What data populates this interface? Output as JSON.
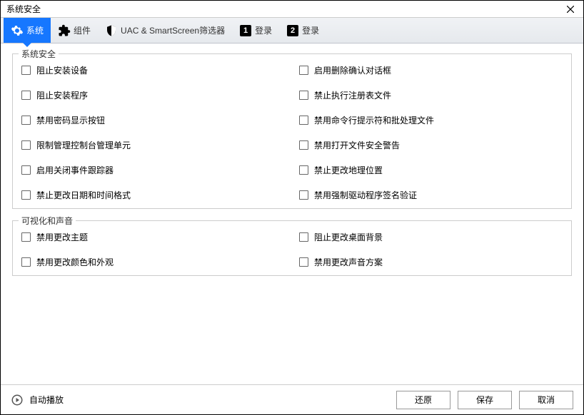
{
  "window": {
    "title": "系统安全"
  },
  "tabs": [
    {
      "label": "系统",
      "icon": "gear"
    },
    {
      "label": "组件",
      "icon": "puzzle"
    },
    {
      "label": "UAC & SmartScreen筛选器",
      "icon": "shield"
    },
    {
      "label": "登录",
      "icon": "num1"
    },
    {
      "label": "登录",
      "icon": "num2"
    }
  ],
  "groups": [
    {
      "title": "系统安全",
      "options": [
        "阻止安装设备",
        "启用删除确认对话框",
        "阻止安装程序",
        "禁止执行注册表文件",
        "禁用密码显示按钮",
        "禁用命令行提示符和批处理文件",
        "限制管理控制台管理单元",
        "禁用打开文件安全警告",
        "启用关闭事件跟踪器",
        "禁止更改地理位置",
        "禁止更改日期和时间格式",
        "禁用强制驱动程序签名验证"
      ]
    },
    {
      "title": "可视化和声音",
      "options": [
        "禁用更改主题",
        "阻止更改桌面背景",
        "禁用更改颜色和外观",
        "禁用更改声音方案"
      ]
    }
  ],
  "footer": {
    "autoplay": "自动播放",
    "restore": "还原",
    "save": "保存",
    "cancel": "取消"
  }
}
